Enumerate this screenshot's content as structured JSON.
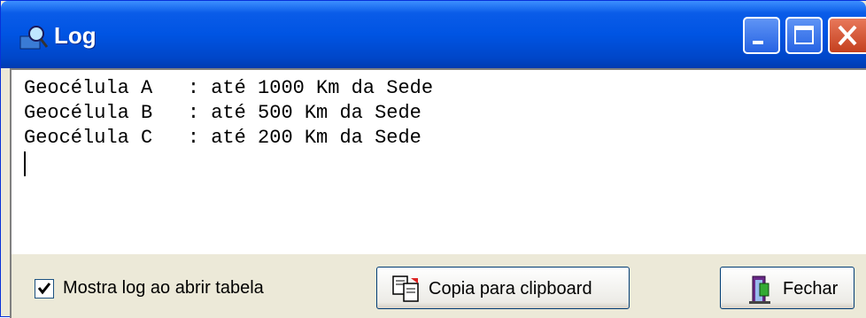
{
  "window": {
    "title": "Log",
    "icon": "magnifier-icon",
    "controls": [
      "minimize-icon",
      "maximize-icon",
      "close-icon"
    ]
  },
  "log": {
    "lines": [
      "Geocélula A   : até 1000 Km da Sede",
      "Geocélula B   : até 500 Km da Sede",
      "Geocélula C   : até 200 Km da Sede"
    ]
  },
  "footer": {
    "checkbox_label": "Mostra log ao abrir tabela",
    "checkbox_checked": true,
    "copy_button_label": "Copia para clipboard",
    "copy_button_icon": "clipboard-copy-icon",
    "close_button_label": "Fechar",
    "close_button_icon": "door-exit-icon"
  },
  "colors": {
    "titlebar": "#0054e3",
    "window_bg": "#ece9d8",
    "close_button": "#d5492a"
  }
}
